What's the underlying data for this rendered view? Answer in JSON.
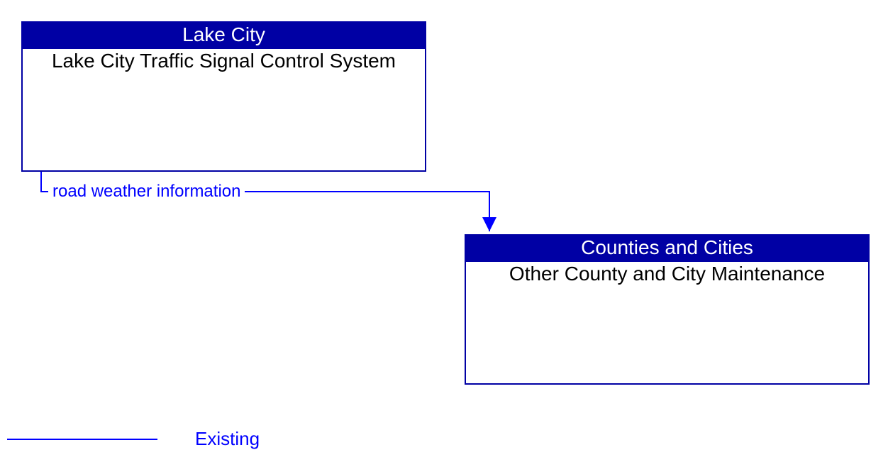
{
  "nodes": {
    "source": {
      "header": "Lake City",
      "body": "Lake City Traffic Signal Control System"
    },
    "target": {
      "header": "Counties and Cities",
      "body": "Other County and City Maintenance"
    }
  },
  "flow": {
    "label": "road weather information"
  },
  "legend": {
    "existing": "Existing"
  },
  "colors": {
    "node_border": "#0000a4",
    "header_bg": "#0000a4",
    "header_text": "#ffffff",
    "body_text": "#000000",
    "flow_line": "#0000ff",
    "flow_text": "#0000ff"
  }
}
